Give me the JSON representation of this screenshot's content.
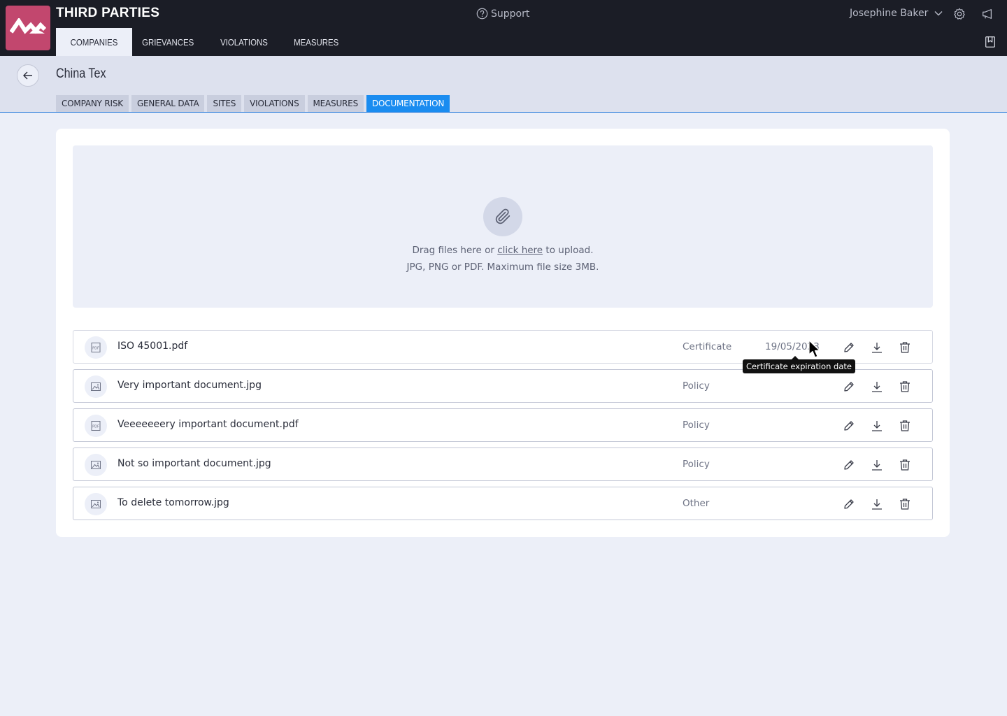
{
  "app": {
    "title": "THIRD PARTIES",
    "support_label": "Support",
    "user_name": "Josephine Baker"
  },
  "main_nav": [
    {
      "label": "COMPANIES",
      "active": true
    },
    {
      "label": "GRIEVANCES",
      "active": false
    },
    {
      "label": "VIOLATIONS",
      "active": false
    },
    {
      "label": "MEASURES",
      "active": false
    }
  ],
  "company": {
    "name": "China Tex"
  },
  "sub_tabs": [
    {
      "label": "COMPANY RISK",
      "active": false
    },
    {
      "label": "GENERAL DATA",
      "active": false
    },
    {
      "label": "SITES",
      "active": false
    },
    {
      "label": "VIOLATIONS",
      "active": false
    },
    {
      "label": "MEASURES",
      "active": false
    },
    {
      "label": "DOCUMENTATION",
      "active": true
    }
  ],
  "upload": {
    "text_before": "Drag files here or ",
    "link_text": "click here",
    "text_after": " to upload.",
    "hint": "JPG, PNG or PDF. Maximum file size 3MB."
  },
  "files": [
    {
      "name": "ISO 45001.pdf",
      "type": "Certificate",
      "date": "19/05/2023",
      "icon": "pdf-file-icon"
    },
    {
      "name": "Very important document.jpg",
      "type": "Policy",
      "date": "",
      "icon": "image-file-icon"
    },
    {
      "name": "Veeeeeeery important document.pdf",
      "type": "Policy",
      "date": "",
      "icon": "pdf-file-icon"
    },
    {
      "name": "Not so important document.jpg",
      "type": "Policy",
      "date": "",
      "icon": "image-file-icon"
    },
    {
      "name": "To delete tomorrow.jpg",
      "type": "Other",
      "date": "",
      "icon": "image-file-icon"
    }
  ],
  "tooltip": {
    "text": "Certificate expiration date"
  },
  "colors": {
    "topbar": "#1b1d26",
    "logo": "#c2476e",
    "active_tab": "#1a8cf0",
    "background": "#eceff8"
  }
}
